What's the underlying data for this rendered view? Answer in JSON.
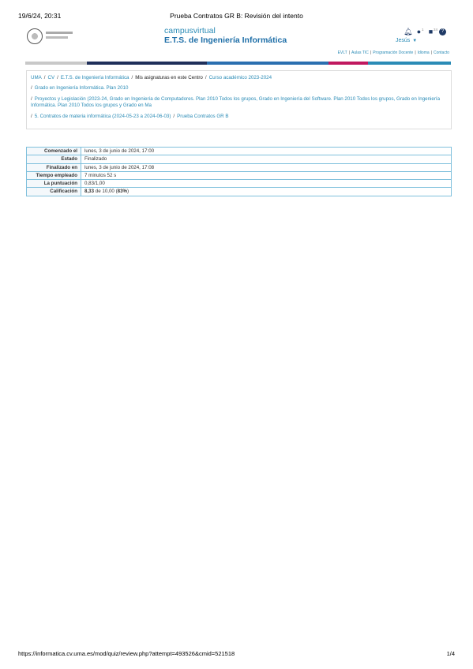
{
  "print": {
    "datetime": "19/6/24, 20:31",
    "title": "Prueba Contratos GR B: Revisión del intento",
    "url": "https://informatica.cv.uma.es/mod/quiz/review.php?attempt=493526&cmid=521518",
    "page": "1/4"
  },
  "header": {
    "brand_line1": "campusvirtual",
    "brand_line2": "E.T.S. de Ingeniería Informática",
    "user_name": "Jesús",
    "messages_badge": "1",
    "notifications_badge": "24"
  },
  "top_links": [
    "EVLT",
    "Aulas TIC",
    "Programación Docente",
    "Idioma",
    "Contacto"
  ],
  "colors": {
    "bar": [
      "#c8c8c8",
      "#1f2f5a",
      "#2a6fb0",
      "#c0185f",
      "#2a8bb6"
    ]
  },
  "breadcrumb": {
    "uma": "UMA",
    "cv": "CV",
    "centro": "E.T.S. de Ingeniería Informática",
    "mis": "Mis asignaturas en este Centro",
    "curso": "Curso académico 2023-2024",
    "grado": "Grado en Ingeniería Informática. Plan 2010",
    "asignatura": "Proyectos y Legislación (2023-24, Grado en Ingeniería de Computadores. Plan 2010 Todos los grupos, Grado en Ingeniería del Software. Plan 2010 Todos los grupos, Grado en Ingeniería Informática. Plan 2010 Todos los grupos y Grado en Ma",
    "tema": "5. Contratos de materia informática (2024-05-23 a 2024-06-03)",
    "prueba": "Prueba Contratos GR B"
  },
  "summary": {
    "rows": [
      {
        "label": "Comenzado el",
        "value": "lunes, 3 de junio de 2024, 17:00"
      },
      {
        "label": "Estado",
        "value": "Finalizado"
      },
      {
        "label": "Finalizado en",
        "value": "lunes, 3 de junio de 2024, 17:08"
      },
      {
        "label": "Tiempo empleado",
        "value": "7 minutos 52 s"
      },
      {
        "label": "La puntuación",
        "value": "0,83/1,00"
      }
    ],
    "grade_label": "Calificación",
    "grade_score": "8,33",
    "grade_mid": "de 10,00 (",
    "grade_percent": "83%",
    "grade_end": ")"
  }
}
